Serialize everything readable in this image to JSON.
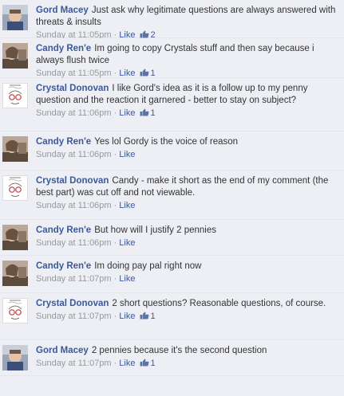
{
  "comments": [
    {
      "author": "Gord Macey",
      "text": "Just ask why legitimate questions are always answered with threats & insults",
      "time": "Sunday at 11:05pm",
      "like": "Like",
      "likes": "2",
      "avatar": "gord-avatar"
    },
    {
      "author": "Candy Ren'e",
      "text": "Im going to copy Crystals stuff and then say because i always flush twice",
      "time": "Sunday at 11:05pm",
      "like": "Like",
      "likes": "1",
      "avatar": "candy-avatar"
    },
    {
      "author": "Crystal Donovan",
      "text": "I like Gord's idea as it is a follow up to my penny question and the reaction it garnered - better to stay on subject?",
      "time": "Sunday at 11:06pm",
      "like": "Like",
      "likes": "1",
      "avatar": "crystal-avatar"
    },
    {
      "author": "Candy Ren'e",
      "text": "Yes lol Gordy is the voice of reason",
      "time": "Sunday at 11:06pm",
      "like": "Like",
      "likes": "",
      "avatar": "candy-avatar"
    },
    {
      "author": "Crystal Donovan",
      "text": "Candy - make it short as the end of my comment (the best part) was cut off and not viewable.",
      "time": "Sunday at 11:06pm",
      "like": "Like",
      "likes": "",
      "avatar": "crystal-avatar"
    },
    {
      "author": "Candy Ren'e",
      "text": "But how will I justify 2 pennies",
      "time": "Sunday at 11:06pm",
      "like": "Like",
      "likes": "",
      "avatar": "candy-avatar"
    },
    {
      "author": "Candy Ren'e",
      "text": "Im doing pay pal right now",
      "time": "Sunday at 11:07pm",
      "like": "Like",
      "likes": "",
      "avatar": "candy-avatar"
    },
    {
      "author": "Crystal Donovan",
      "text": "2 short questions? Reasonable questions, of course.",
      "time": "Sunday at 11:07pm",
      "like": "Like",
      "likes": "1",
      "avatar": "crystal-avatar"
    },
    {
      "author": "Gord Macey",
      "text": "2 pennies because it's the second question",
      "time": "Sunday at 11:07pm",
      "like": "Like",
      "likes": "1",
      "avatar": "gord-avatar"
    }
  ],
  "separator": "·"
}
